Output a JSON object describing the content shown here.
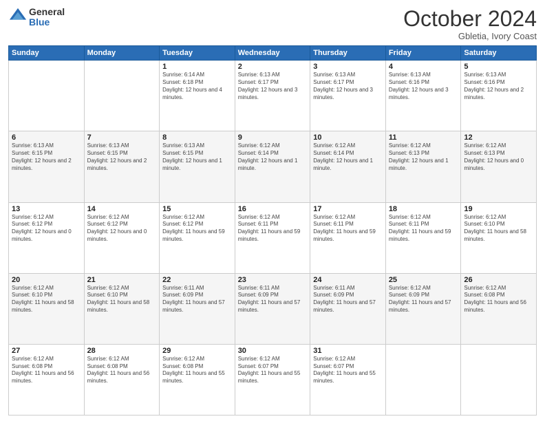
{
  "logo": {
    "general": "General",
    "blue": "Blue"
  },
  "header": {
    "month": "October 2024",
    "location": "Gbletia, Ivory Coast"
  },
  "weekdays": [
    "Sunday",
    "Monday",
    "Tuesday",
    "Wednesday",
    "Thursday",
    "Friday",
    "Saturday"
  ],
  "weeks": [
    [
      null,
      null,
      {
        "day": "1",
        "sunrise": "Sunrise: 6:14 AM",
        "sunset": "Sunset: 6:18 PM",
        "daylight": "Daylight: 12 hours and 4 minutes."
      },
      {
        "day": "2",
        "sunrise": "Sunrise: 6:13 AM",
        "sunset": "Sunset: 6:17 PM",
        "daylight": "Daylight: 12 hours and 3 minutes."
      },
      {
        "day": "3",
        "sunrise": "Sunrise: 6:13 AM",
        "sunset": "Sunset: 6:17 PM",
        "daylight": "Daylight: 12 hours and 3 minutes."
      },
      {
        "day": "4",
        "sunrise": "Sunrise: 6:13 AM",
        "sunset": "Sunset: 6:16 PM",
        "daylight": "Daylight: 12 hours and 3 minutes."
      },
      {
        "day": "5",
        "sunrise": "Sunrise: 6:13 AM",
        "sunset": "Sunset: 6:16 PM",
        "daylight": "Daylight: 12 hours and 2 minutes."
      }
    ],
    [
      {
        "day": "6",
        "sunrise": "Sunrise: 6:13 AM",
        "sunset": "Sunset: 6:15 PM",
        "daylight": "Daylight: 12 hours and 2 minutes."
      },
      {
        "day": "7",
        "sunrise": "Sunrise: 6:13 AM",
        "sunset": "Sunset: 6:15 PM",
        "daylight": "Daylight: 12 hours and 2 minutes."
      },
      {
        "day": "8",
        "sunrise": "Sunrise: 6:13 AM",
        "sunset": "Sunset: 6:15 PM",
        "daylight": "Daylight: 12 hours and 1 minute."
      },
      {
        "day": "9",
        "sunrise": "Sunrise: 6:12 AM",
        "sunset": "Sunset: 6:14 PM",
        "daylight": "Daylight: 12 hours and 1 minute."
      },
      {
        "day": "10",
        "sunrise": "Sunrise: 6:12 AM",
        "sunset": "Sunset: 6:14 PM",
        "daylight": "Daylight: 12 hours and 1 minute."
      },
      {
        "day": "11",
        "sunrise": "Sunrise: 6:12 AM",
        "sunset": "Sunset: 6:13 PM",
        "daylight": "Daylight: 12 hours and 1 minute."
      },
      {
        "day": "12",
        "sunrise": "Sunrise: 6:12 AM",
        "sunset": "Sunset: 6:13 PM",
        "daylight": "Daylight: 12 hours and 0 minutes."
      }
    ],
    [
      {
        "day": "13",
        "sunrise": "Sunrise: 6:12 AM",
        "sunset": "Sunset: 6:12 PM",
        "daylight": "Daylight: 12 hours and 0 minutes."
      },
      {
        "day": "14",
        "sunrise": "Sunrise: 6:12 AM",
        "sunset": "Sunset: 6:12 PM",
        "daylight": "Daylight: 12 hours and 0 minutes."
      },
      {
        "day": "15",
        "sunrise": "Sunrise: 6:12 AM",
        "sunset": "Sunset: 6:12 PM",
        "daylight": "Daylight: 11 hours and 59 minutes."
      },
      {
        "day": "16",
        "sunrise": "Sunrise: 6:12 AM",
        "sunset": "Sunset: 6:11 PM",
        "daylight": "Daylight: 11 hours and 59 minutes."
      },
      {
        "day": "17",
        "sunrise": "Sunrise: 6:12 AM",
        "sunset": "Sunset: 6:11 PM",
        "daylight": "Daylight: 11 hours and 59 minutes."
      },
      {
        "day": "18",
        "sunrise": "Sunrise: 6:12 AM",
        "sunset": "Sunset: 6:11 PM",
        "daylight": "Daylight: 11 hours and 59 minutes."
      },
      {
        "day": "19",
        "sunrise": "Sunrise: 6:12 AM",
        "sunset": "Sunset: 6:10 PM",
        "daylight": "Daylight: 11 hours and 58 minutes."
      }
    ],
    [
      {
        "day": "20",
        "sunrise": "Sunrise: 6:12 AM",
        "sunset": "Sunset: 6:10 PM",
        "daylight": "Daylight: 11 hours and 58 minutes."
      },
      {
        "day": "21",
        "sunrise": "Sunrise: 6:12 AM",
        "sunset": "Sunset: 6:10 PM",
        "daylight": "Daylight: 11 hours and 58 minutes."
      },
      {
        "day": "22",
        "sunrise": "Sunrise: 6:11 AM",
        "sunset": "Sunset: 6:09 PM",
        "daylight": "Daylight: 11 hours and 57 minutes."
      },
      {
        "day": "23",
        "sunrise": "Sunrise: 6:11 AM",
        "sunset": "Sunset: 6:09 PM",
        "daylight": "Daylight: 11 hours and 57 minutes."
      },
      {
        "day": "24",
        "sunrise": "Sunrise: 6:11 AM",
        "sunset": "Sunset: 6:09 PM",
        "daylight": "Daylight: 11 hours and 57 minutes."
      },
      {
        "day": "25",
        "sunrise": "Sunrise: 6:12 AM",
        "sunset": "Sunset: 6:09 PM",
        "daylight": "Daylight: 11 hours and 57 minutes."
      },
      {
        "day": "26",
        "sunrise": "Sunrise: 6:12 AM",
        "sunset": "Sunset: 6:08 PM",
        "daylight": "Daylight: 11 hours and 56 minutes."
      }
    ],
    [
      {
        "day": "27",
        "sunrise": "Sunrise: 6:12 AM",
        "sunset": "Sunset: 6:08 PM",
        "daylight": "Daylight: 11 hours and 56 minutes."
      },
      {
        "day": "28",
        "sunrise": "Sunrise: 6:12 AM",
        "sunset": "Sunset: 6:08 PM",
        "daylight": "Daylight: 11 hours and 56 minutes."
      },
      {
        "day": "29",
        "sunrise": "Sunrise: 6:12 AM",
        "sunset": "Sunset: 6:08 PM",
        "daylight": "Daylight: 11 hours and 55 minutes."
      },
      {
        "day": "30",
        "sunrise": "Sunrise: 6:12 AM",
        "sunset": "Sunset: 6:07 PM",
        "daylight": "Daylight: 11 hours and 55 minutes."
      },
      {
        "day": "31",
        "sunrise": "Sunrise: 6:12 AM",
        "sunset": "Sunset: 6:07 PM",
        "daylight": "Daylight: 11 hours and 55 minutes."
      },
      null,
      null
    ]
  ]
}
